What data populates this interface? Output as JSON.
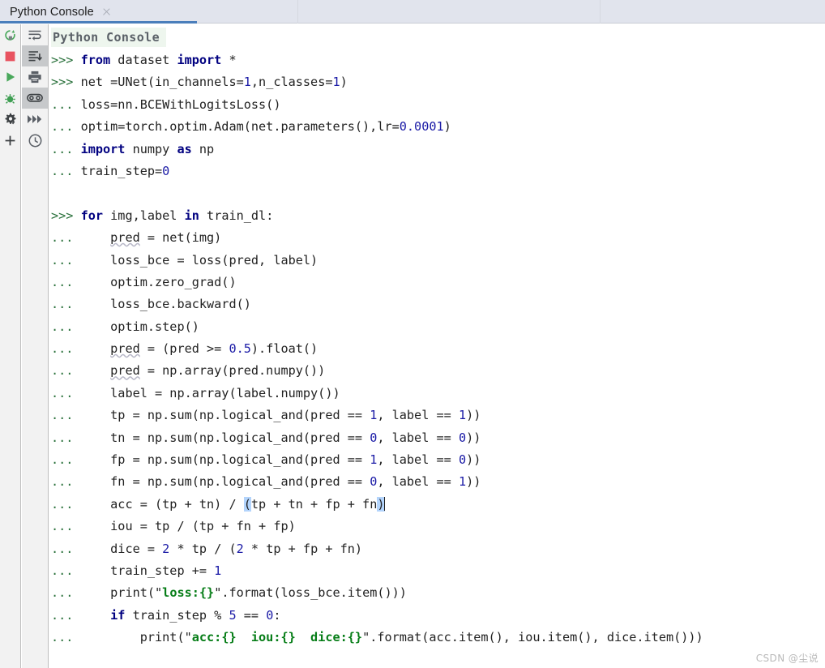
{
  "window": {
    "tab_bar": {
      "tabs": [
        {
          "label": "Python Console",
          "close_icon": "close-icon",
          "active": true
        }
      ],
      "accent_color": "#4a7ebb",
      "background_color": "#e1e4ed"
    }
  },
  "left_toolbar_primary": {
    "buttons": [
      {
        "name": "rerun-icon",
        "tooltip": "Rerun Console",
        "color": "#49a85b"
      },
      {
        "name": "stop-icon",
        "tooltip": "Stop",
        "color": "#e8525f"
      },
      {
        "name": "execute-icon",
        "tooltip": "Execute Current Statement",
        "color": "#49a85b"
      },
      {
        "name": "debug-icon",
        "tooltip": "Attach Debugger",
        "color": "#49a85b"
      },
      {
        "name": "settings-icon",
        "tooltip": "Settings",
        "color": "#3c4043"
      },
      {
        "name": "plus-icon",
        "tooltip": "New Console",
        "color": "#3c4043"
      }
    ]
  },
  "left_toolbar_secondary": {
    "buttons": [
      {
        "name": "soft-wrap-icon",
        "tooltip": "Use Soft Wraps",
        "active": false
      },
      {
        "name": "scroll-to-end-icon",
        "tooltip": "Scroll to the End",
        "active": true
      },
      {
        "name": "print-icon",
        "tooltip": "Print",
        "active": false
      },
      {
        "name": "variables-icon",
        "tooltip": "Show Variables",
        "active": true
      },
      {
        "name": "skip-forward-icon",
        "tooltip": "Skip All Breakpoints",
        "active": false
      },
      {
        "name": "history-icon",
        "tooltip": "Command History",
        "active": false
      }
    ]
  },
  "console": {
    "header": "Python Console",
    "header_background": "#eef6ee",
    "prompt_primary": ">>>",
    "prompt_continuation": "...",
    "lines": [
      {
        "prompt": ">>>",
        "segments": [
          {
            "t": "kw",
            "v": "from"
          },
          {
            "t": "p",
            "v": " dataset "
          },
          {
            "t": "kw",
            "v": "import"
          },
          {
            "t": "p",
            "v": " *"
          }
        ]
      },
      {
        "prompt": ">>>",
        "segments": [
          {
            "t": "p",
            "v": "net =UNet(in_channels="
          },
          {
            "t": "num",
            "v": "1"
          },
          {
            "t": "p",
            "v": ",n_classes="
          },
          {
            "t": "num",
            "v": "1"
          },
          {
            "t": "p",
            "v": ")"
          }
        ]
      },
      {
        "prompt": "...",
        "segments": [
          {
            "t": "p",
            "v": "loss=nn.BCEWithLogitsLoss()"
          }
        ]
      },
      {
        "prompt": "...",
        "segments": [
          {
            "t": "p",
            "v": "optim=torch.optim.Adam(net.parameters(),lr="
          },
          {
            "t": "num",
            "v": "0.0001"
          },
          {
            "t": "p",
            "v": ")"
          }
        ]
      },
      {
        "prompt": "...",
        "segments": [
          {
            "t": "kw",
            "v": "import"
          },
          {
            "t": "p",
            "v": " numpy "
          },
          {
            "t": "kw",
            "v": "as"
          },
          {
            "t": "p",
            "v": " np"
          }
        ]
      },
      {
        "prompt": "...",
        "segments": [
          {
            "t": "p",
            "v": "train_step="
          },
          {
            "t": "num",
            "v": "0"
          }
        ]
      },
      {
        "prompt": "",
        "segments": []
      },
      {
        "prompt": ">>>",
        "segments": [
          {
            "t": "kw",
            "v": "for"
          },
          {
            "t": "p",
            "v": " img,label "
          },
          {
            "t": "kw",
            "v": "in"
          },
          {
            "t": "p",
            "v": " train_dl:"
          }
        ]
      },
      {
        "prompt": "...",
        "segments": [
          {
            "t": "p",
            "v": "    "
          },
          {
            "t": "warn",
            "v": "pred"
          },
          {
            "t": "p",
            "v": " = net(img)"
          }
        ]
      },
      {
        "prompt": "...",
        "segments": [
          {
            "t": "p",
            "v": "    loss_bce = loss(pred, label)"
          }
        ]
      },
      {
        "prompt": "...",
        "segments": [
          {
            "t": "p",
            "v": "    optim.zero_grad()"
          }
        ]
      },
      {
        "prompt": "...",
        "segments": [
          {
            "t": "p",
            "v": "    loss_bce.backward()"
          }
        ]
      },
      {
        "prompt": "...",
        "segments": [
          {
            "t": "p",
            "v": "    optim.step()"
          }
        ]
      },
      {
        "prompt": "...",
        "segments": [
          {
            "t": "p",
            "v": "    "
          },
          {
            "t": "warn",
            "v": "pred"
          },
          {
            "t": "p",
            "v": " = (pred >= "
          },
          {
            "t": "num",
            "v": "0.5"
          },
          {
            "t": "p",
            "v": ").float()"
          }
        ]
      },
      {
        "prompt": "...",
        "segments": [
          {
            "t": "p",
            "v": "    "
          },
          {
            "t": "warn",
            "v": "pred"
          },
          {
            "t": "p",
            "v": " = np.array(pred.numpy())"
          }
        ]
      },
      {
        "prompt": "...",
        "segments": [
          {
            "t": "p",
            "v": "    label = np.array(label.numpy())"
          }
        ]
      },
      {
        "prompt": "...",
        "segments": [
          {
            "t": "p",
            "v": "    tp = np.sum(np.logical_and(pred == "
          },
          {
            "t": "num",
            "v": "1"
          },
          {
            "t": "p",
            "v": ", label == "
          },
          {
            "t": "num",
            "v": "1"
          },
          {
            "t": "p",
            "v": "))"
          }
        ]
      },
      {
        "prompt": "...",
        "segments": [
          {
            "t": "p",
            "v": "    tn = np.sum(np.logical_and(pred == "
          },
          {
            "t": "num",
            "v": "0"
          },
          {
            "t": "p",
            "v": ", label == "
          },
          {
            "t": "num",
            "v": "0"
          },
          {
            "t": "p",
            "v": "))"
          }
        ]
      },
      {
        "prompt": "...",
        "segments": [
          {
            "t": "p",
            "v": "    fp = np.sum(np.logical_and(pred == "
          },
          {
            "t": "num",
            "v": "1"
          },
          {
            "t": "p",
            "v": ", label == "
          },
          {
            "t": "num",
            "v": "0"
          },
          {
            "t": "p",
            "v": "))"
          }
        ]
      },
      {
        "prompt": "...",
        "segments": [
          {
            "t": "p",
            "v": "    fn = np.sum(np.logical_and(pred == "
          },
          {
            "t": "num",
            "v": "0"
          },
          {
            "t": "p",
            "v": ", label == "
          },
          {
            "t": "num",
            "v": "1"
          },
          {
            "t": "p",
            "v": "))"
          }
        ]
      },
      {
        "prompt": "...",
        "segments": [
          {
            "t": "p",
            "v": "    acc = (tp + tn) / "
          },
          {
            "t": "brk",
            "v": "("
          },
          {
            "t": "p",
            "v": "tp + tn + fp + fn"
          },
          {
            "t": "brk",
            "v": ")"
          },
          {
            "t": "caret",
            "v": ""
          }
        ]
      },
      {
        "prompt": "...",
        "segments": [
          {
            "t": "p",
            "v": "    iou = tp / (tp + fn + fp)"
          }
        ]
      },
      {
        "prompt": "...",
        "segments": [
          {
            "t": "p",
            "v": "    dice = "
          },
          {
            "t": "num",
            "v": "2"
          },
          {
            "t": "p",
            "v": " * tp / ("
          },
          {
            "t": "num",
            "v": "2"
          },
          {
            "t": "p",
            "v": " * tp + fp + fn)"
          }
        ]
      },
      {
        "prompt": "...",
        "segments": [
          {
            "t": "p",
            "v": "    train_step += "
          },
          {
            "t": "num",
            "v": "1"
          }
        ]
      },
      {
        "prompt": "...",
        "segments": [
          {
            "t": "p",
            "v": "    print("
          },
          {
            "t": "q",
            "v": "\""
          },
          {
            "t": "str",
            "v": "loss:{}"
          },
          {
            "t": "q",
            "v": "\""
          },
          {
            "t": "p",
            "v": ".format(loss_bce.item()))"
          }
        ]
      },
      {
        "prompt": "...",
        "segments": [
          {
            "t": "p",
            "v": "    "
          },
          {
            "t": "kw",
            "v": "if"
          },
          {
            "t": "p",
            "v": " train_step % "
          },
          {
            "t": "num",
            "v": "5"
          },
          {
            "t": "p",
            "v": " == "
          },
          {
            "t": "num",
            "v": "0"
          },
          {
            "t": "p",
            "v": ":"
          }
        ]
      },
      {
        "prompt": "...",
        "segments": [
          {
            "t": "p",
            "v": "        print("
          },
          {
            "t": "q",
            "v": "\""
          },
          {
            "t": "str",
            "v": "acc:{}  iou:{}  dice:{}"
          },
          {
            "t": "q",
            "v": "\""
          },
          {
            "t": "p",
            "v": ".format(acc.item(), iou.item(), dice.item()))"
          }
        ]
      }
    ]
  },
  "watermark": {
    "text": "CSDN @尘说"
  }
}
